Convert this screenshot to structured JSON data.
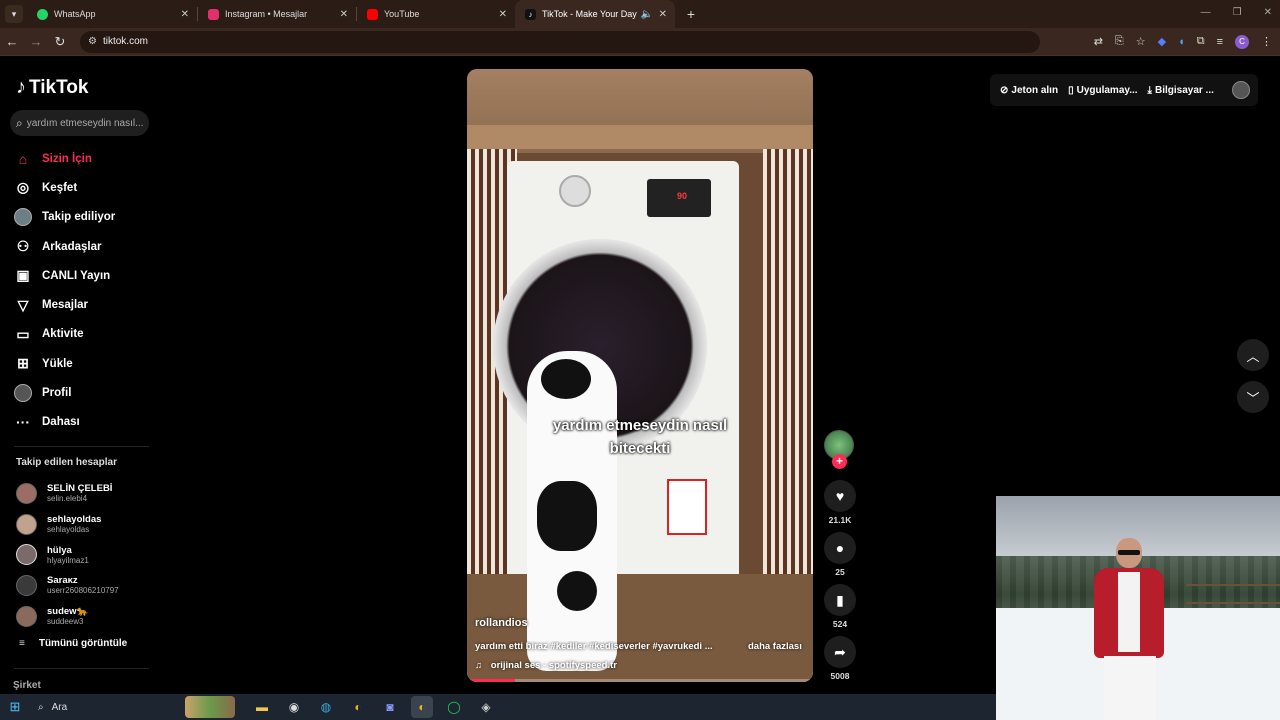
{
  "browser": {
    "tabs": [
      {
        "label": "WhatsApp",
        "color": "#25d366"
      },
      {
        "label": "Instagram • Mesajlar",
        "color": "#e1306c"
      },
      {
        "label": "YouTube",
        "color": "#ff0000"
      },
      {
        "label": "TikTok - Make Your Day",
        "color": "#000000"
      }
    ],
    "url": "tiktok.com"
  },
  "sidebar": {
    "logo": "TikTok",
    "search_placeholder": "yardım etmeseydin nasıl...",
    "menu": [
      {
        "label": "Sizin İçin",
        "icon": "home-icon"
      },
      {
        "label": "Keşfet",
        "icon": "compass-icon"
      },
      {
        "label": "Takip ediliyor",
        "icon": "avatar-icon"
      },
      {
        "label": "Arkadaşlar",
        "icon": "friends-icon"
      },
      {
        "label": "CANLI Yayın",
        "icon": "live-icon"
      },
      {
        "label": "Mesajlar",
        "icon": "send-icon"
      },
      {
        "label": "Aktivite",
        "icon": "inbox-icon"
      },
      {
        "label": "Yükle",
        "icon": "plus-square-icon"
      },
      {
        "label": "Profil",
        "icon": "profile-icon"
      },
      {
        "label": "Dahası",
        "icon": "more-icon"
      }
    ],
    "following_title": "Takip edilen hesaplar",
    "following": [
      {
        "name": "SELİN ÇELEBİ",
        "user": "selin.elebi4"
      },
      {
        "name": "sehlayoldas",
        "user": "sehlayoldas"
      },
      {
        "name": "hülya",
        "user": "hlyayilmaz1"
      },
      {
        "name": "Saraᴋᴢ",
        "user": "userr260806210797"
      },
      {
        "name": "sudew🐆",
        "user": "suddeew3"
      }
    ],
    "see_all": "Tümünü görüntüle",
    "company": "Şirket"
  },
  "topright": {
    "coins": "Jeton alın",
    "app": "Uygulamay...",
    "desktop": "Bilgisayar ..."
  },
  "video": {
    "overlay_line1": "yardım etmeseydin nasıl",
    "overlay_line2": "bitecekti",
    "washer_display": "90",
    "author": "rollandios",
    "description": "yardım etti biraz #kediler #kediseverler #yavrukedi ...",
    "more": "daha fazlası",
    "music": "orijinal ses - spotifyspeed.tr",
    "progress": 0.14
  },
  "actions": {
    "likes": "21.1K",
    "comments": "25",
    "saves": "524",
    "shares": "5008"
  },
  "taskbar": {
    "search": "Ara"
  }
}
